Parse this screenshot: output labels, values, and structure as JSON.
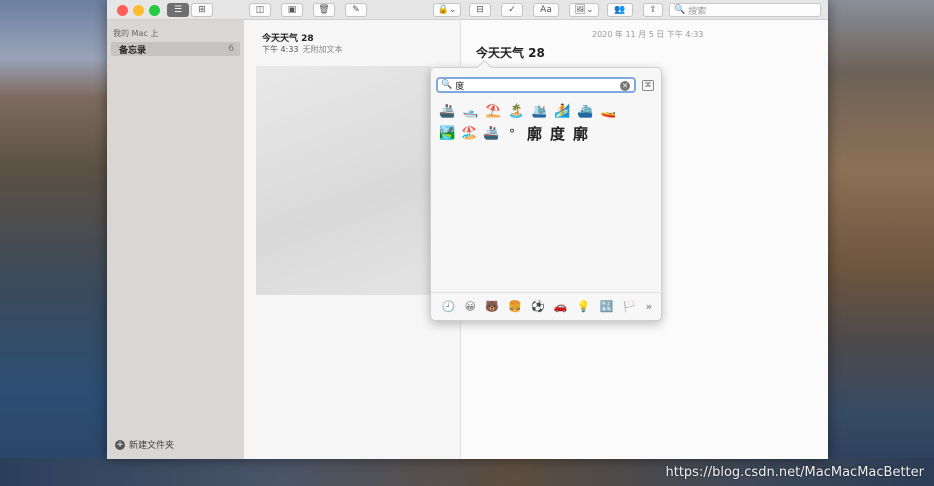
{
  "toolbar": {
    "format_label": "Aa",
    "search_placeholder": "搜索"
  },
  "sidebar": {
    "section_label": "我的 Mac 上",
    "folder_name": "备忘录",
    "folder_count": "6",
    "new_folder_label": "新建文件夹"
  },
  "notelist": {
    "note_title": "今天天气 28",
    "note_time": "下午 4:33",
    "note_sub": "无附加文本"
  },
  "editor": {
    "date": "2020 年 11 月 5 日 下午 4:33",
    "title": "今天天气 28"
  },
  "picker": {
    "query": "度",
    "row1": [
      "🚢",
      "🛥️",
      "⛱️",
      "🏝️",
      "🛳️",
      "🏄",
      "⛴️",
      "🚤"
    ],
    "row2_emojis": [
      "🏞️",
      "🏖️",
      "🚢"
    ],
    "row2_deg": "°",
    "row2_chars": [
      "廓",
      "度",
      "廓"
    ],
    "category_icons": [
      "🕘",
      "😀",
      "🐻",
      "🍔",
      "⚽",
      "🚗",
      "💡",
      "🔣",
      "🏳️",
      "»"
    ]
  },
  "watermark": "https://blog.csdn.net/MacMacMacBetter"
}
